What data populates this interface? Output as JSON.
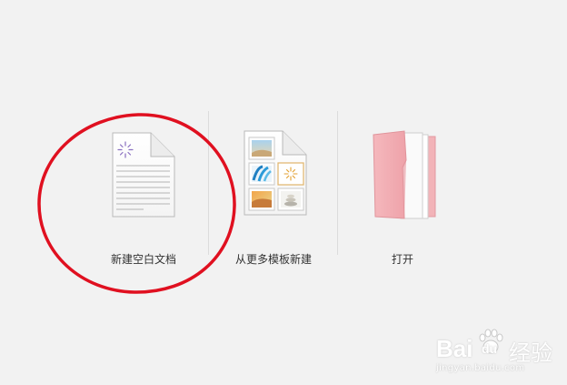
{
  "options": [
    {
      "label": "新建空白文档",
      "icon": "blank-document-icon"
    },
    {
      "label": "从更多模板新建",
      "icon": "template-document-icon"
    },
    {
      "label": "打开",
      "icon": "pink-folder-icon"
    }
  ],
  "annotation": {
    "shape": "circle",
    "color": "#e01020"
  },
  "watermark": {
    "brand": "Bai",
    "brand_suffix": "du",
    "product": "经验",
    "url": "jingyan.baidu.com"
  },
  "colors": {
    "background": "#f2f2f2",
    "folder_pink": "#f0a8ae",
    "label_text": "#333333"
  }
}
